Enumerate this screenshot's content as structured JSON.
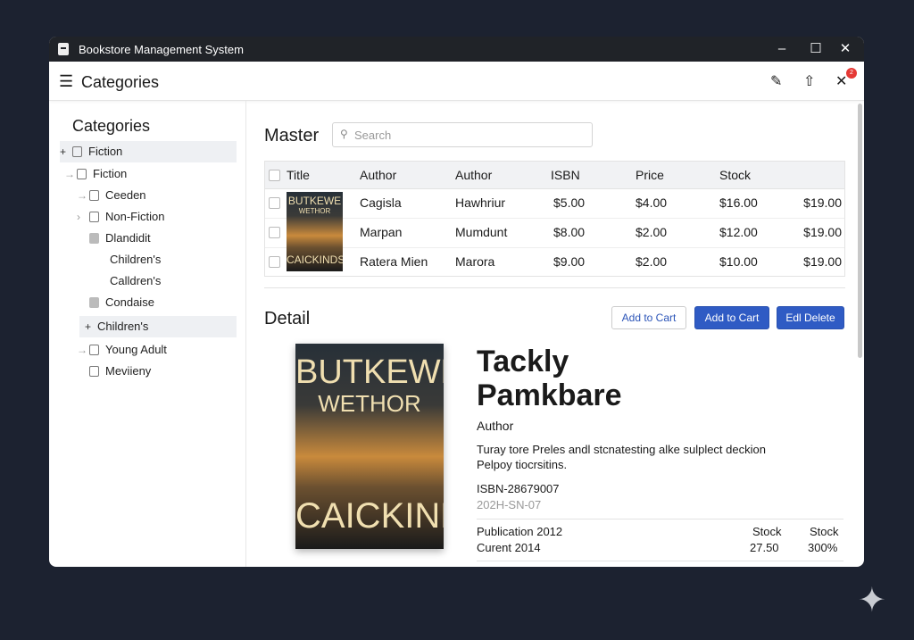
{
  "window": {
    "title": "Bookstore Management System"
  },
  "header": {
    "title": "Categories",
    "badge_count": "2"
  },
  "sidebar": {
    "heading": "Categories",
    "items": [
      {
        "label": "Fiction",
        "expander": "+",
        "selected": true
      },
      {
        "label": "Fiction",
        "expander": "→"
      },
      {
        "label": "Ceeden",
        "expander": "→"
      },
      {
        "label": "Non-Fiction",
        "expander": "›"
      },
      {
        "label": "Dlandidit",
        "expander": ""
      },
      {
        "label": "Children's",
        "expander": ""
      },
      {
        "label": "Calldren's",
        "expander": ""
      },
      {
        "label": "Condaise",
        "expander": ""
      },
      {
        "label": "Children's",
        "expander": "+",
        "selected": true
      },
      {
        "label": "Young Adult",
        "expander": "→"
      },
      {
        "label": "Meviieny",
        "expander": ""
      }
    ]
  },
  "master": {
    "heading": "Master",
    "search_placeholder": "Search",
    "columns": [
      "Title",
      "Author",
      "Author",
      "ISBN",
      "Price",
      "Stock"
    ],
    "rows": [
      [
        "Cagisla",
        "Hawhriur",
        "$5.00",
        "$4.00",
        "$16.00",
        "$19.00"
      ],
      [
        "Marpan",
        "Mumdunt",
        "$8.00",
        "$2.00",
        "$12.00",
        "$19.00"
      ],
      [
        "Ratera Mien",
        "Marora",
        "$9.00",
        "$2.00",
        "$10.00",
        "$19.00"
      ]
    ]
  },
  "cover": {
    "line1": "BUTKEWE",
    "line2": "WETHOR",
    "line3": "CAICKINDS"
  },
  "detail": {
    "heading": "Detail",
    "buttons": [
      "Add to Cart",
      "Add to Cart",
      "Edl Delete"
    ],
    "title_line1": "Tackly",
    "title_line2": "Pamkbare",
    "author": "Author",
    "desc1": "Turay tore Preles andl stcnatesting alke sulplect deckion",
    "desc2": "Pelpoy tiocrsitins.",
    "isbn": "ISBN-28679007",
    "isbn2": "202H-SN-07",
    "pub": "Publication 2012",
    "cur": "Curent 2014",
    "stock_h1": "Stock",
    "stock_h2": "Stock",
    "stock_v1": "27.50",
    "stock_v2": "300%"
  },
  "colors": {
    "primary": "#2f5bc4",
    "titlebar": "#202328",
    "badge": "#e53935"
  }
}
